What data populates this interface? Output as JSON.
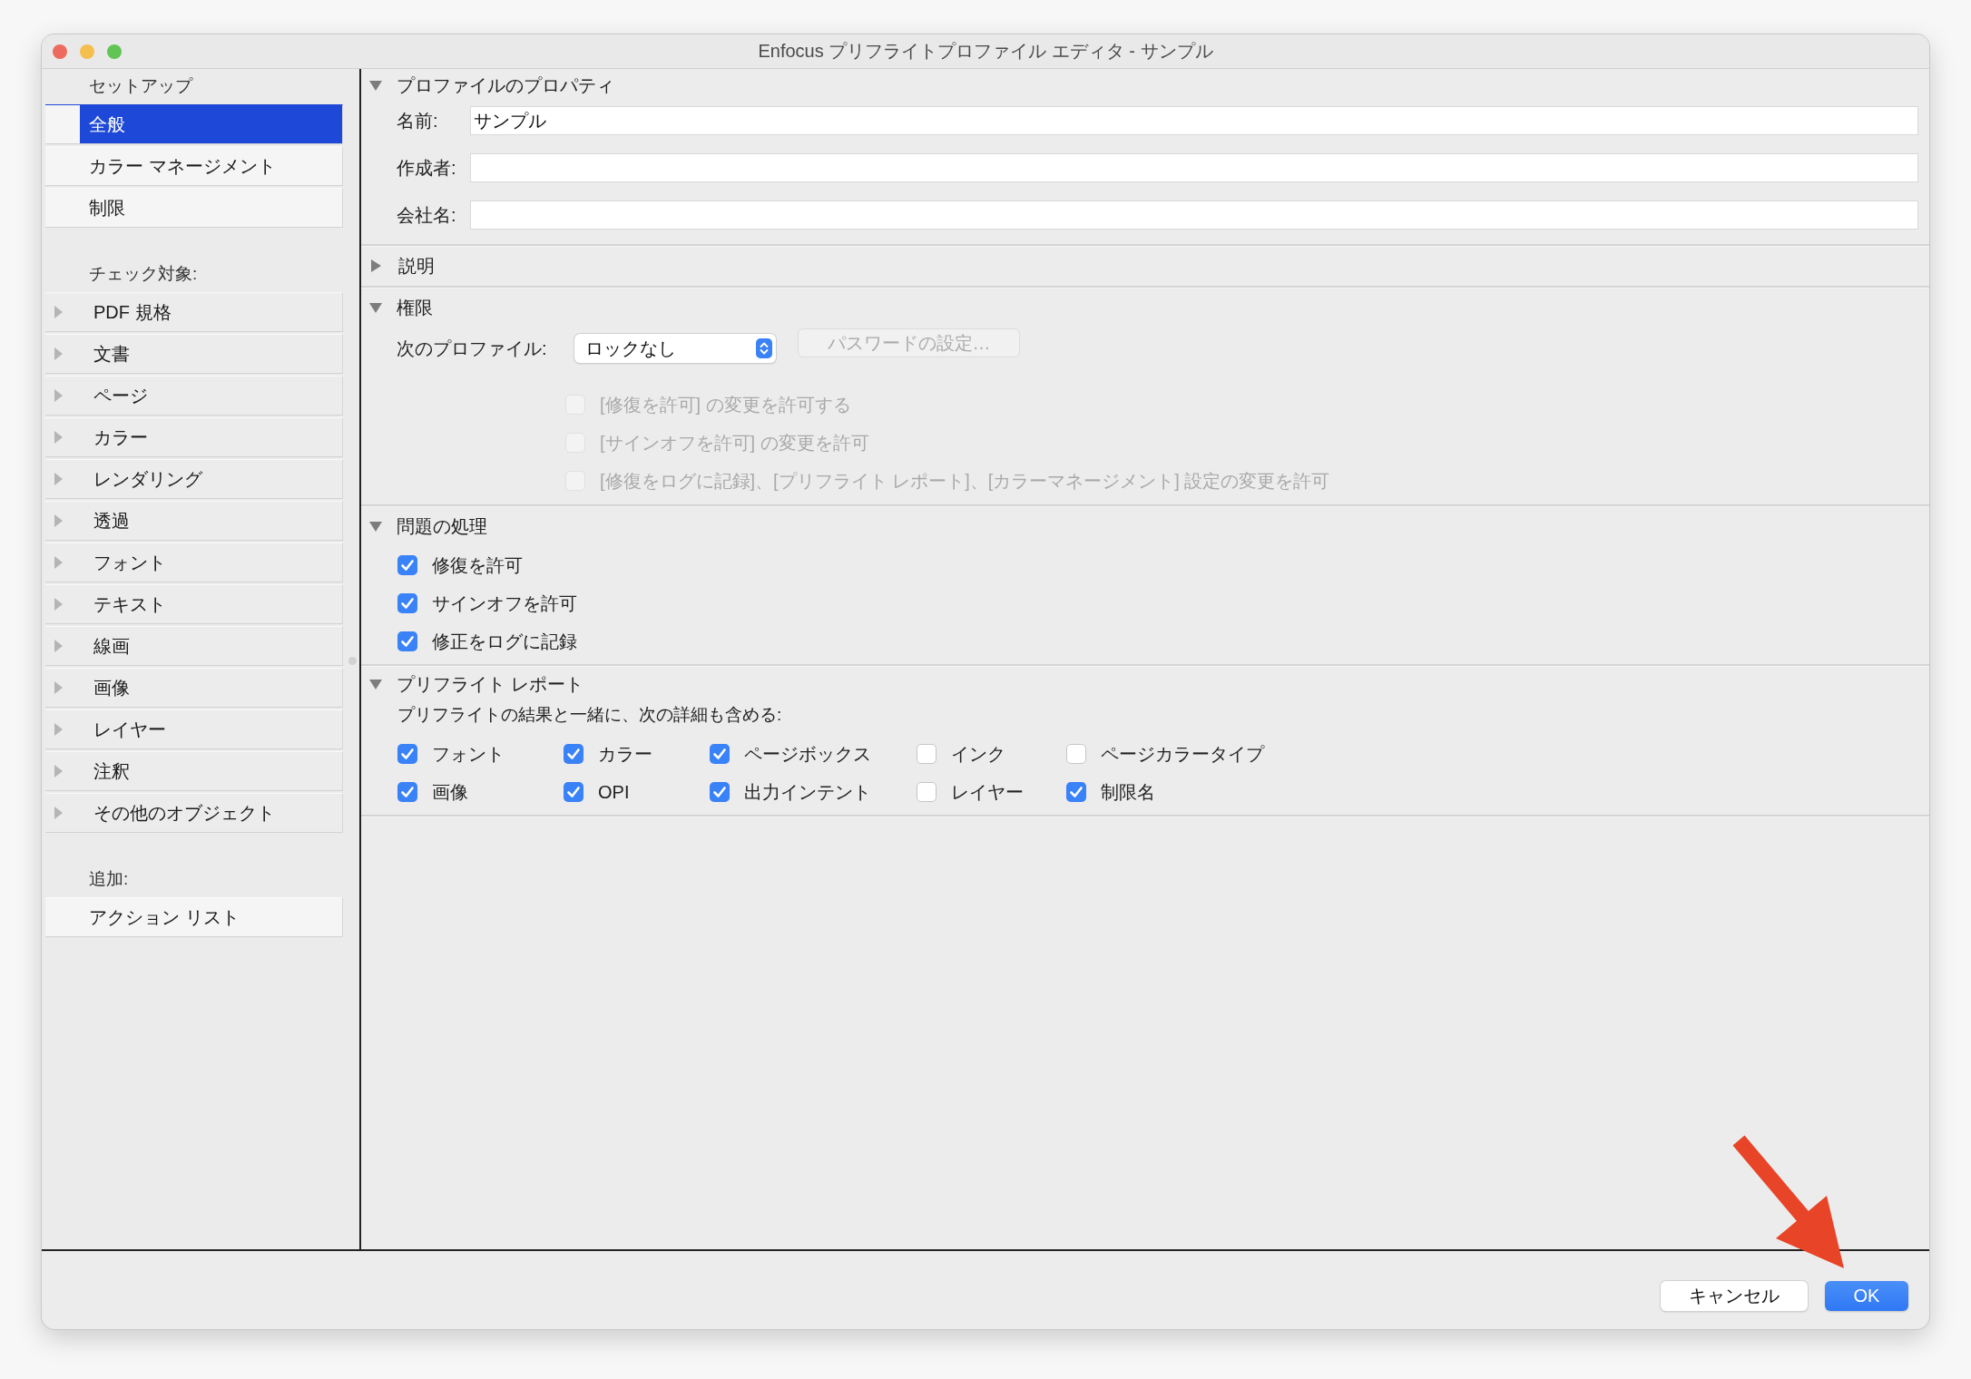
{
  "window": {
    "title": "Enfocus プリフライトプロファイル エディタ - サンプル"
  },
  "sidebar": {
    "groups": [
      {
        "heading": "セットアップ",
        "items": [
          {
            "label": "全般",
            "kind": "plain",
            "selected": true
          },
          {
            "label": "カラー マネージメント",
            "kind": "plain",
            "selected": false
          },
          {
            "label": "制限",
            "kind": "plain",
            "selected": false
          }
        ]
      },
      {
        "heading": "チェック対象:",
        "items": [
          {
            "label": "PDF 規格",
            "kind": "disclosure",
            "selected": false,
            "expanded": false
          },
          {
            "label": "文書",
            "kind": "disclosure",
            "selected": false,
            "expanded": false
          },
          {
            "label": "ページ",
            "kind": "disclosure",
            "selected": false,
            "expanded": false
          },
          {
            "label": "カラー",
            "kind": "disclosure",
            "selected": false,
            "expanded": false
          },
          {
            "label": "レンダリング",
            "kind": "disclosure",
            "selected": false,
            "expanded": false
          },
          {
            "label": "透過",
            "kind": "disclosure",
            "selected": false,
            "expanded": false
          },
          {
            "label": "フォント",
            "kind": "disclosure",
            "selected": false,
            "expanded": false
          },
          {
            "label": "テキスト",
            "kind": "disclosure",
            "selected": false,
            "expanded": false
          },
          {
            "label": "線画",
            "kind": "disclosure",
            "selected": false,
            "expanded": false
          },
          {
            "label": "画像",
            "kind": "disclosure",
            "selected": false,
            "expanded": false
          },
          {
            "label": "レイヤー",
            "kind": "disclosure",
            "selected": false,
            "expanded": false
          },
          {
            "label": "注釈",
            "kind": "disclosure",
            "selected": false,
            "expanded": false
          },
          {
            "label": "その他のオブジェクト",
            "kind": "disclosure",
            "selected": false,
            "expanded": false
          }
        ]
      },
      {
        "heading": "追加:",
        "items": [
          {
            "label": "アクション リスト",
            "kind": "plain",
            "selected": false
          }
        ]
      }
    ]
  },
  "sections": [
    {
      "kind": "fields",
      "title": "プロファイルのプロパティ",
      "expanded": true,
      "fields": [
        {
          "label": "名前:",
          "value": "サンプル"
        },
        {
          "label": "作成者:"
        },
        {
          "label": "会社名:"
        }
      ]
    },
    {
      "kind": "description",
      "title": "説明",
      "expanded": false
    },
    {
      "kind": "permissions",
      "title": "権限",
      "expanded": true,
      "profile_label": "次のプロファイル:",
      "dropdown": {
        "value": "ロックなし"
      },
      "password_button": {
        "label": "パスワードの設定…",
        "disabled": true
      },
      "options": [
        {
          "label": "[修復を許可] の変更を許可する",
          "checked": false,
          "disabled": true
        },
        {
          "label": "[サインオフを許可] の変更を許可",
          "checked": false,
          "disabled": true
        },
        {
          "label": "[修復をログに記録]、[プリフライト レポート]、[カラーマネージメント] 設定の変更を許可",
          "checked": false,
          "disabled": true
        }
      ]
    },
    {
      "kind": "checks",
      "title": "問題の処理",
      "expanded": true,
      "options": [
        {
          "label": "修復を許可",
          "checked": true,
          "disabled": false
        },
        {
          "label": "サインオフを許可",
          "checked": true,
          "disabled": false
        },
        {
          "label": "修正をログに記録",
          "checked": true,
          "disabled": false
        }
      ]
    },
    {
      "kind": "report",
      "title": "プリフライト レポート",
      "expanded": true,
      "description": "プリフライトの結果と一緒に、次の詳細も含める:",
      "options": [
        {
          "label": "フォント",
          "checked": true,
          "disabled": false
        },
        {
          "label": "カラー",
          "checked": true,
          "disabled": false
        },
        {
          "label": "ページボックス",
          "checked": true,
          "disabled": false
        },
        {
          "label": "インク",
          "checked": false,
          "disabled": false
        },
        {
          "label": "ページカラータイプ",
          "checked": false,
          "disabled": false
        },
        {
          "label": "画像",
          "checked": true,
          "disabled": false
        },
        {
          "label": "OPI",
          "checked": true,
          "disabled": false
        },
        {
          "label": "出力インテント",
          "checked": true,
          "disabled": false
        },
        {
          "label": "レイヤー",
          "checked": false,
          "disabled": false
        },
        {
          "label": "制限名",
          "checked": true,
          "disabled": false
        }
      ]
    }
  ],
  "buttons": [
    {
      "label": "キャンセル",
      "primary": false
    },
    {
      "label": "OK",
      "primary": true
    }
  ]
}
